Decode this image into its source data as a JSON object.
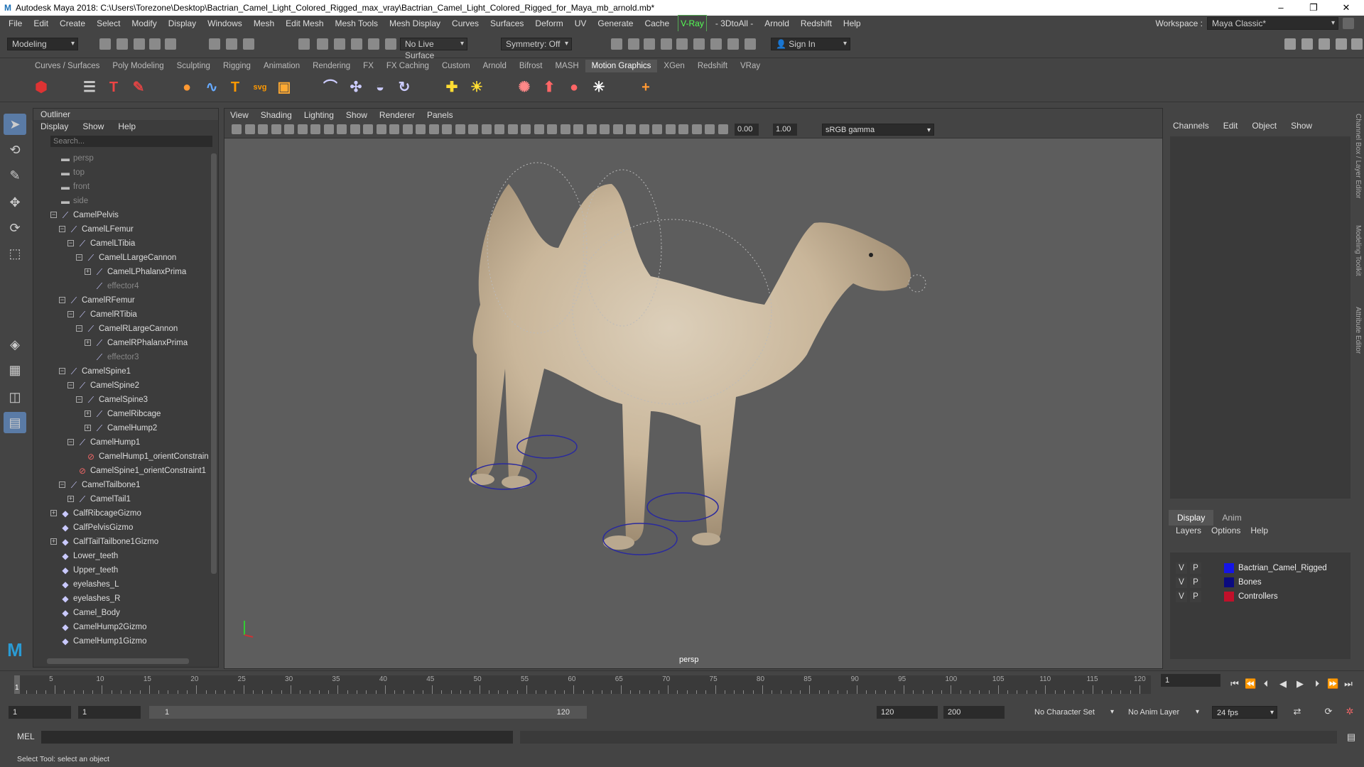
{
  "window": {
    "title": "Autodesk Maya 2018: C:\\Users\\Torezone\\Desktop\\Bactrian_Camel_Light_Colored_Rigged_max_vray\\Bactrian_Camel_Light_Colored_Rigged_for_Maya_mb_arnold.mb*",
    "app_icon": "maya-icon"
  },
  "menubar": {
    "items": [
      "File",
      "Edit",
      "Create",
      "Select",
      "Modify",
      "Display",
      "Windows",
      "Mesh",
      "Edit Mesh",
      "Mesh Tools",
      "Mesh Display",
      "Curves",
      "Surfaces",
      "Deform",
      "UV",
      "Generate",
      "Cache",
      "V-Ray",
      "- 3DtoAll -",
      "Arnold",
      "Redshift",
      "Help"
    ],
    "workspace_label": "Workspace :",
    "workspace_value": "Maya Classic*"
  },
  "statusline": {
    "mode": "Modeling",
    "live_surface": "No Live Surface",
    "symmetry": "Symmetry: Off",
    "sign_in": "Sign In"
  },
  "shelf": {
    "tabs": [
      "Curves / Surfaces",
      "Poly Modeling",
      "Sculpting",
      "Rigging",
      "Animation",
      "Rendering",
      "FX",
      "FX Caching",
      "Custom",
      "Arnold",
      "Bifrost",
      "MASH",
      "Motion Graphics",
      "XGen",
      "Redshift",
      "VRay"
    ],
    "active_tab": "Motion Graphics"
  },
  "outliner": {
    "title": "Outliner",
    "menu": [
      "Display",
      "Show",
      "Help"
    ],
    "search_placeholder": "Search...",
    "items": [
      {
        "label": "persp",
        "depth": 0,
        "type": "camera",
        "dim": true
      },
      {
        "label": "top",
        "depth": 0,
        "type": "camera",
        "dim": true
      },
      {
        "label": "front",
        "depth": 0,
        "type": "camera",
        "dim": true
      },
      {
        "label": "side",
        "depth": 0,
        "type": "camera",
        "dim": true
      },
      {
        "label": "CamelPelvis",
        "depth": 0,
        "type": "joint",
        "exp": "-"
      },
      {
        "label": "CamelLFemur",
        "depth": 1,
        "type": "joint",
        "exp": "-"
      },
      {
        "label": "CamelLTibia",
        "depth": 2,
        "type": "joint",
        "exp": "-"
      },
      {
        "label": "CamelLLargeCannon",
        "depth": 3,
        "type": "joint",
        "exp": "-"
      },
      {
        "label": "CamelLPhalanxPrima",
        "depth": 4,
        "type": "joint",
        "exp": "+"
      },
      {
        "label": "effector4",
        "depth": 4,
        "type": "joint",
        "dim": true
      },
      {
        "label": "CamelRFemur",
        "depth": 1,
        "type": "joint",
        "exp": "-"
      },
      {
        "label": "CamelRTibia",
        "depth": 2,
        "type": "joint",
        "exp": "-"
      },
      {
        "label": "CamelRLargeCannon",
        "depth": 3,
        "type": "joint",
        "exp": "-"
      },
      {
        "label": "CamelRPhalanxPrima",
        "depth": 4,
        "type": "joint",
        "exp": "+"
      },
      {
        "label": "effector3",
        "depth": 4,
        "type": "joint",
        "dim": true
      },
      {
        "label": "CamelSpine1",
        "depth": 1,
        "type": "joint",
        "exp": "-"
      },
      {
        "label": "CamelSpine2",
        "depth": 2,
        "type": "joint",
        "exp": "-"
      },
      {
        "label": "CamelSpine3",
        "depth": 3,
        "type": "joint",
        "exp": "-"
      },
      {
        "label": "CamelRibcage",
        "depth": 4,
        "type": "joint",
        "exp": "+"
      },
      {
        "label": "CamelHump2",
        "depth": 4,
        "type": "joint",
        "exp": "+"
      },
      {
        "label": "CamelHump1",
        "depth": 2,
        "type": "joint",
        "exp": "-"
      },
      {
        "label": "CamelHump1_orientConstrain",
        "depth": 3,
        "type": "constraint"
      },
      {
        "label": "CamelSpine1_orientConstraint1",
        "depth": 2,
        "type": "constraint"
      },
      {
        "label": "CamelTailbone1",
        "depth": 1,
        "type": "joint",
        "exp": "-"
      },
      {
        "label": "CamelTail1",
        "depth": 2,
        "type": "joint",
        "exp": "+"
      },
      {
        "label": "CalfRibcageGizmo",
        "depth": 0,
        "type": "transform",
        "exp": "+"
      },
      {
        "label": "CalfPelvisGizmo",
        "depth": 0,
        "type": "transform"
      },
      {
        "label": "CalfTailTailbone1Gizmo",
        "depth": 0,
        "type": "transform",
        "exp": "+"
      },
      {
        "label": "Lower_teeth",
        "depth": 0,
        "type": "transform"
      },
      {
        "label": "Upper_teeth",
        "depth": 0,
        "type": "transform"
      },
      {
        "label": "eyelashes_L",
        "depth": 0,
        "type": "transform"
      },
      {
        "label": "eyelashes_R",
        "depth": 0,
        "type": "transform"
      },
      {
        "label": "Camel_Body",
        "depth": 0,
        "type": "transform"
      },
      {
        "label": "CamelHump2Gizmo",
        "depth": 0,
        "type": "transform"
      },
      {
        "label": "CamelHump1Gizmo",
        "depth": 0,
        "type": "transform"
      }
    ]
  },
  "viewport": {
    "menu": [
      "View",
      "Shading",
      "Lighting",
      "Show",
      "Renderer",
      "Panels"
    ],
    "exposure": "0.00",
    "gamma": "1.00",
    "color_space": "sRGB gamma",
    "camera_label": "persp"
  },
  "channelbox": {
    "menu": [
      "Channels",
      "Edit",
      "Object",
      "Show"
    ]
  },
  "layers": {
    "tabs": [
      "Display",
      "Anim"
    ],
    "active_tab": "Display",
    "menu": [
      "Layers",
      "Options",
      "Help"
    ],
    "rows": [
      {
        "v": "V",
        "p": "P",
        "name": "Bactrian_Camel_Rigged",
        "color": "#1515e6"
      },
      {
        "v": "V",
        "p": "P",
        "name": "Bones",
        "color": "#0a0a80"
      },
      {
        "v": "V",
        "p": "P",
        "name": "Controllers",
        "color": "#c0102a"
      }
    ]
  },
  "side_tabs": [
    "Channel Box / Layer Editor",
    "Modeling Toolkit",
    "Attribute Editor"
  ],
  "timeline": {
    "start": 1,
    "end": 120,
    "ticks": [
      5,
      10,
      15,
      20,
      25,
      30,
      35,
      40,
      45,
      50,
      55,
      60,
      65,
      70,
      75,
      80,
      85,
      90,
      95,
      100,
      105,
      110,
      115,
      120
    ],
    "current_frame_label": "1",
    "current_frame_field": "1"
  },
  "range": {
    "start": "1",
    "playback_start": "1",
    "slider_start": "1",
    "slider_end": "120",
    "playback_end": "120",
    "end": "200",
    "character_set": "No Character Set",
    "anim_layer": "No Anim Layer",
    "fps": "24 fps"
  },
  "command": {
    "label": "MEL"
  },
  "helpline": "Select Tool: select an object"
}
